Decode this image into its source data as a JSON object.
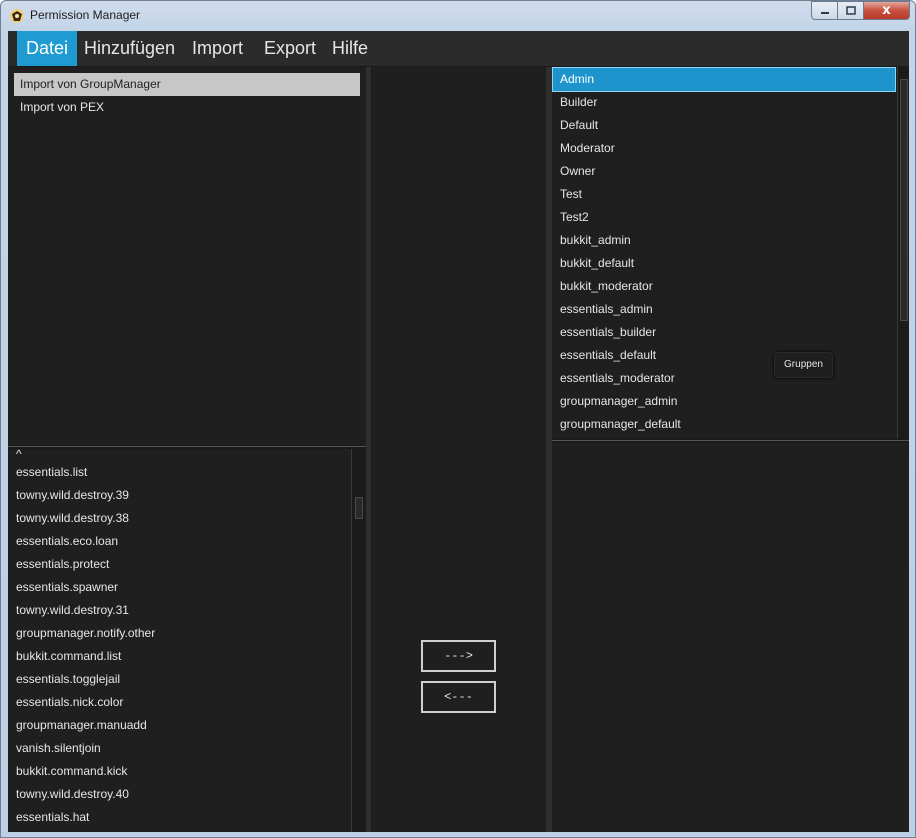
{
  "window": {
    "title": "Permission Manager"
  },
  "menu": [
    "Datei",
    "Hinzufügen",
    "Import",
    "Export",
    "Hilfe"
  ],
  "import_menu": [
    "Import von GroupManager",
    "Import von PEX"
  ],
  "permissions": {
    "top_marker": "^",
    "items": [
      "essentials.list",
      "towny.wild.destroy.39",
      "towny.wild.destroy.38",
      "essentials.eco.loan",
      "essentials.protect",
      "essentials.spawner",
      "towny.wild.destroy.31",
      "groupmanager.notify.other",
      "bukkit.command.list",
      "essentials.togglejail",
      "essentials.nick.color",
      "groupmanager.manuadd",
      "vanish.silentjoin",
      "bukkit.command.kick",
      "towny.wild.destroy.40",
      "essentials.hat"
    ]
  },
  "buttons": {
    "add": "--->",
    "remove": "<---"
  },
  "groups": [
    "Admin",
    "Builder",
    "Default",
    "Moderator",
    "Owner",
    "Test",
    "Test2",
    "bukkit_admin",
    "bukkit_default",
    "bukkit_moderator",
    "essentials_admin",
    "essentials_builder",
    "essentials_default",
    "essentials_moderator",
    "groupmanager_admin",
    "groupmanager_default"
  ],
  "tooltip": "Gruppen",
  "window_controls": {
    "close": "x"
  }
}
